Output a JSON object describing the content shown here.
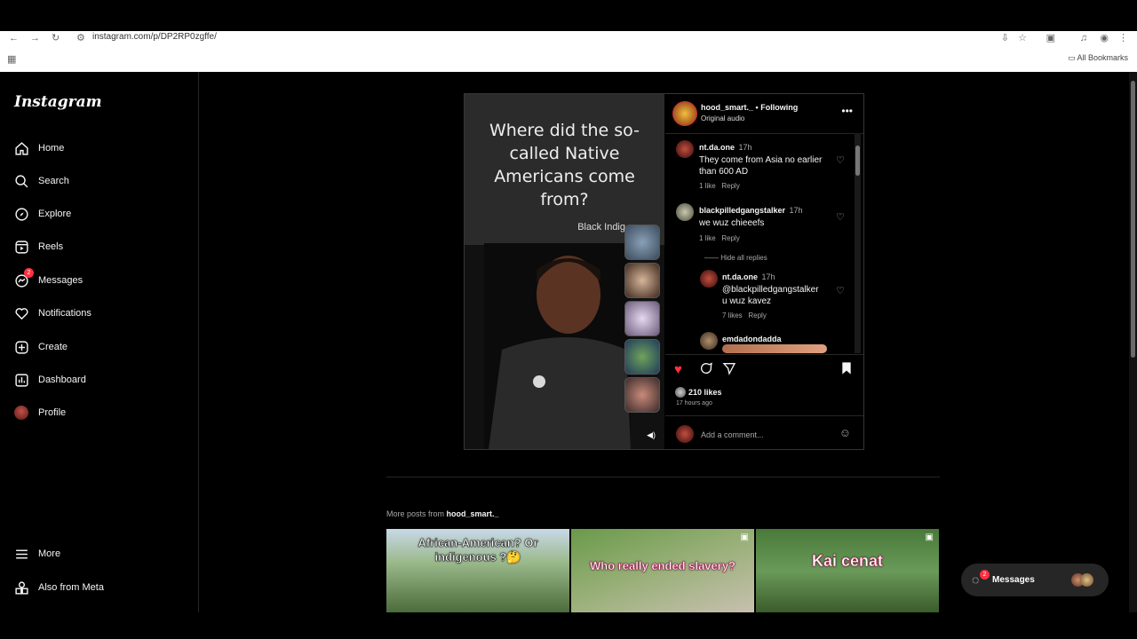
{
  "browser": {
    "url": "instagram.com/p/DP2RP0zgffe/",
    "bookmarks_label": "All Bookmarks",
    "icons": [
      "back-icon",
      "forward-icon",
      "reload-icon",
      "site-info-icon",
      "install-icon",
      "star-icon",
      "tab-search-icon",
      "media-icon",
      "profile-icon",
      "menu-icon",
      "apps-icon",
      "folder-icon"
    ]
  },
  "sidebar": {
    "logo": "Instagram",
    "items": [
      {
        "label": "Home",
        "icon": "home-icon"
      },
      {
        "label": "Search",
        "icon": "search-icon"
      },
      {
        "label": "Explore",
        "icon": "compass-icon"
      },
      {
        "label": "Reels",
        "icon": "reels-icon"
      },
      {
        "label": "Messages",
        "icon": "messenger-icon",
        "badge": "2"
      },
      {
        "label": "Notifications",
        "icon": "heart-icon"
      },
      {
        "label": "Create",
        "icon": "plus-square-icon"
      },
      {
        "label": "Dashboard",
        "icon": "chart-icon"
      },
      {
        "label": "Profile",
        "icon": "avatar-icon"
      }
    ],
    "bottom": [
      {
        "label": "More",
        "icon": "hamburger-icon"
      },
      {
        "label": "Also from Meta",
        "icon": "meta-icon"
      }
    ]
  },
  "post": {
    "media": {
      "question": "Where did the so-called Native Americans come from?",
      "subtitle": "Black Indig"
    },
    "header": {
      "username": "hood_smart._",
      "separator": "•",
      "follow": "Following",
      "audio": "Original audio"
    },
    "comments": [
      {
        "user": "nt.da.one",
        "time": "17h",
        "text": "They come from Asia no earlier than 600 AD",
        "likes": "1 like",
        "reply": "Reply"
      },
      {
        "user": "blackpilledgangstalker",
        "time": "17h",
        "text": "we wuz chieeefs",
        "likes": "1 like",
        "reply": "Reply"
      },
      {
        "hide_replies": "Hide all replies"
      },
      {
        "user": "nt.da.one",
        "time": "17h",
        "mention": "@blackpilledgangstalker",
        "text": "u wuz kavez",
        "likes": "7 likes",
        "reply": "Reply"
      },
      {
        "user": "emdadondadda"
      }
    ],
    "likes": "210 likes",
    "ago": "17 hours ago",
    "add_comment_placeholder": "Add a comment...",
    "colors": {
      "liked": "#ff3040",
      "mention": "#8fa7ff"
    }
  },
  "more_posts": {
    "prefix": "More posts from ",
    "user": "hood_smart._",
    "tiles": [
      {
        "caption": "African-American? Or indigenous ?🤔"
      },
      {
        "caption": "Who really ended slavery?"
      },
      {
        "caption": "Kai cenat"
      }
    ]
  },
  "messages_pill": {
    "label": "Messages",
    "badge": "2"
  }
}
